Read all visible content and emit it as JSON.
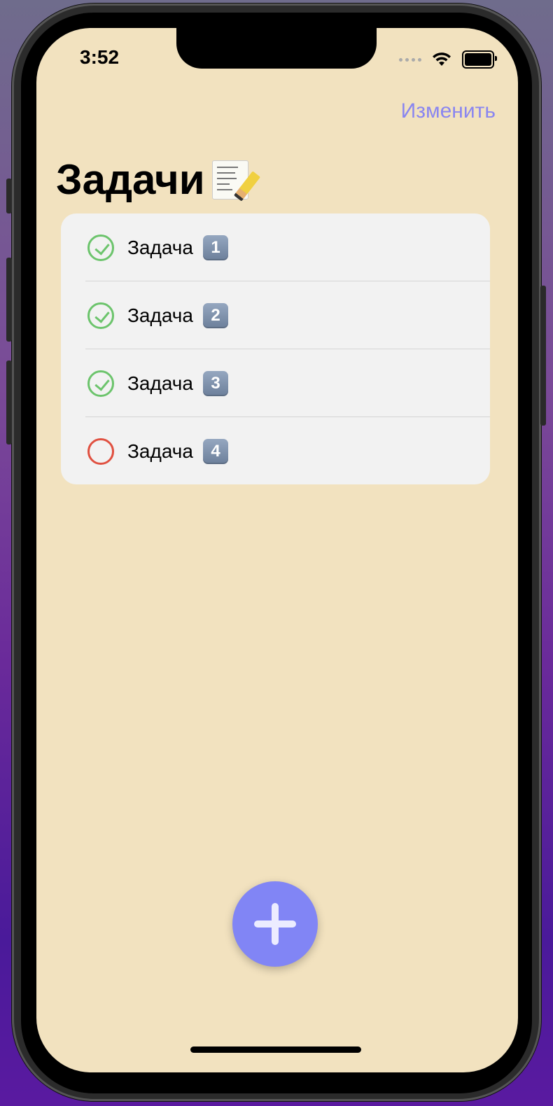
{
  "status_bar": {
    "time": "3:52"
  },
  "nav": {
    "edit_label": "Изменить"
  },
  "header": {
    "title": "Задачи",
    "title_icon": "memo-icon"
  },
  "tasks": [
    {
      "label": "Задача",
      "number": "1",
      "done": true
    },
    {
      "label": "Задача",
      "number": "2",
      "done": true
    },
    {
      "label": "Задача",
      "number": "3",
      "done": true
    },
    {
      "label": "Задача",
      "number": "4",
      "done": false
    }
  ],
  "colors": {
    "background": "#f2e2bf",
    "accent": "#8185f5",
    "done": "#6cc46c",
    "todo": "#e05040",
    "list_bg": "#f2f2f2"
  }
}
